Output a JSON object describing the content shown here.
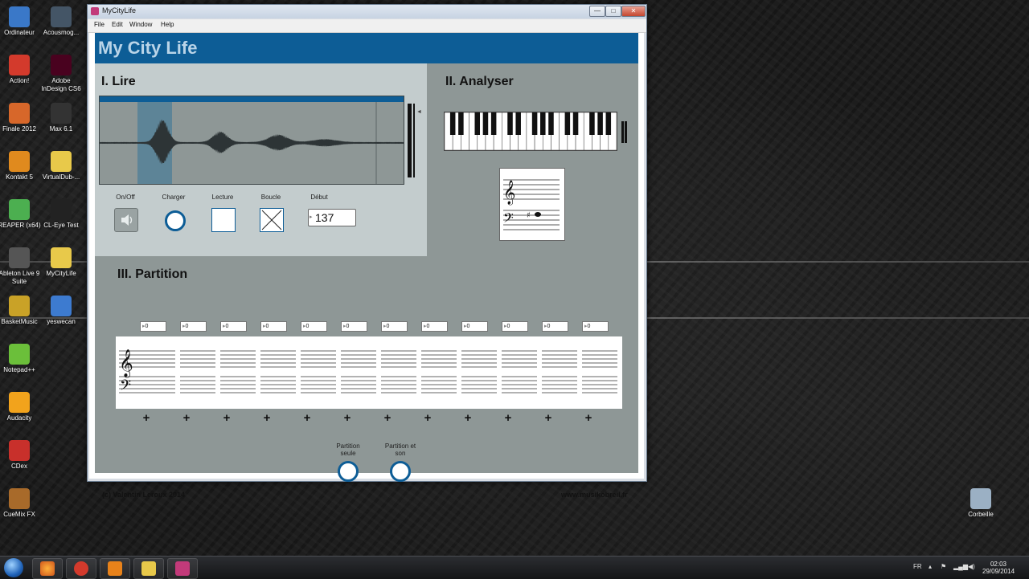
{
  "desktop": {
    "icons": [
      {
        "label": "Ordinateur",
        "icon": "computer-icon",
        "color": "#3a78c8"
      },
      {
        "label": "Acousmog...",
        "icon": "acousmographe-icon",
        "color": "#445566"
      },
      {
        "label": "Action!",
        "icon": "action-icon",
        "color": "#d33a2c"
      },
      {
        "label": "Adobe InDesign CS6",
        "icon": "indesign-icon",
        "color": "#49021f"
      },
      {
        "label": "Finale 2012",
        "icon": "finale-icon",
        "color": "#d7672a"
      },
      {
        "label": "Max 6.1",
        "icon": "max-icon",
        "color": "#333333"
      },
      {
        "label": "Kontakt 5",
        "icon": "kontakt-icon",
        "color": "#e08a1e"
      },
      {
        "label": "VirtualDub-...",
        "icon": "folder-icon",
        "color": "#e8c94a"
      },
      {
        "label": "REAPER (x64)",
        "icon": "reaper-icon",
        "color": "#4caf50"
      },
      {
        "label": "CL-Eye Test",
        "icon": "camera-icon",
        "color": "#222222"
      },
      {
        "label": "Ableton Live 9 Suite",
        "icon": "ableton-icon",
        "color": "#555555"
      },
      {
        "label": "MyCityLife",
        "icon": "folder-icon",
        "color": "#e8c94a"
      },
      {
        "label": "BasketMusic",
        "icon": "file-icon",
        "color": "#c9a227"
      },
      {
        "label": "yeswecan",
        "icon": "wav-file-icon",
        "color": "#3d7bd0"
      },
      {
        "label": "Notepad++",
        "icon": "notepad-icon",
        "color": "#6bbf3a"
      },
      {
        "label": "Audacity",
        "icon": "audacity-icon",
        "color": "#f2a31c"
      },
      {
        "label": "CDex",
        "icon": "cdex-icon",
        "color": "#c8302b"
      },
      {
        "label": "CueMix FX",
        "icon": "cuemix-icon",
        "color": "#a86a2a"
      },
      {
        "label": "Corbeille",
        "icon": "recycle-bin-icon",
        "color": "#9bb0c4"
      }
    ]
  },
  "window": {
    "title": "MyCityLife",
    "menu": [
      "File",
      "Edit",
      "Window",
      "Help"
    ],
    "controls": {
      "min": "—",
      "max": "□",
      "close": "✕"
    }
  },
  "app": {
    "title": "My City Life",
    "colors": {
      "accent": "#0d5d96",
      "panel_light": "#c3cccd",
      "panel_dark": "#8e9796"
    },
    "lire": {
      "title": "I. Lire",
      "controls": {
        "onoff": "On/Off",
        "charger": "Charger",
        "lecture": "Lecture",
        "boucle": "Boucle",
        "debut": "Début"
      },
      "debut_value": "137"
    },
    "analyser": {
      "title": "II. Analyser"
    },
    "partition": {
      "title": "III. Partition",
      "measures": [
        "0",
        "0",
        "0",
        "0",
        "0",
        "0",
        "0",
        "0",
        "0",
        "0",
        "0",
        "0"
      ],
      "options": [
        "Partition seule",
        "Partition et son"
      ]
    },
    "footer": {
      "left": "(c) Valentin Leroux 2014",
      "right": "www.musikobreil.fr"
    }
  },
  "taskbar": {
    "lang": "FR",
    "time": "02:03",
    "date": "29/09/2014"
  }
}
